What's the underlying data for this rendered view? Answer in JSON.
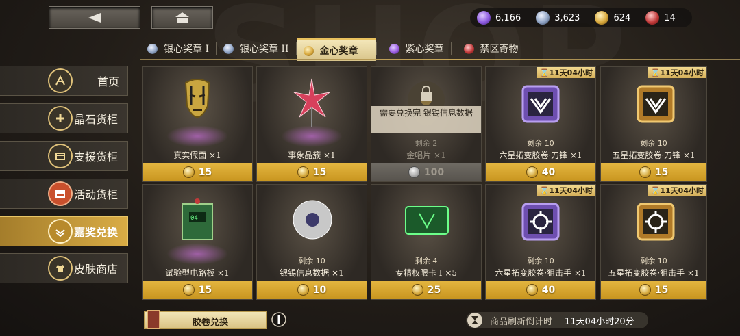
{
  "currencies": [
    {
      "icon": "purple-crystal-icon",
      "value": "6,166",
      "color": "#8d5be0"
    },
    {
      "icon": "silver-badge-icon",
      "value": "3,623",
      "color": "#8fa3c4"
    },
    {
      "icon": "gold-badge-icon",
      "value": "624",
      "color": "#d8a83c"
    },
    {
      "icon": "red-token-icon",
      "value": "14",
      "color": "#c23a3a"
    }
  ],
  "tabs": [
    {
      "label": "银心奖章 I",
      "gem": "#8fa3c4"
    },
    {
      "label": "银心奖章 II",
      "gem": "#8fa3c4"
    },
    {
      "label": "金心奖章",
      "gem": "#d8a83c"
    },
    {
      "label": "紫心奖章",
      "gem": "#9a5de0"
    },
    {
      "label": "禁区奇物",
      "gem": "#c23a3a"
    }
  ],
  "sidebar": [
    {
      "label": "首页",
      "icon": "home-icon"
    },
    {
      "label": "晶石货柜",
      "icon": "crystal-icon"
    },
    {
      "label": "支援货柜",
      "icon": "supply-box-icon"
    },
    {
      "label": "活动货柜",
      "icon": "event-box-icon"
    },
    {
      "label": "嘉奖兑换",
      "icon": "reward-exchange-icon"
    },
    {
      "label": "皮肤商店",
      "icon": "skin-shop-icon"
    }
  ],
  "items": [
    {
      "name": "真实假面 ×1",
      "price": "15",
      "remain": "",
      "timer": ""
    },
    {
      "name": "事象晶簇 ×1",
      "price": "15",
      "remain": "",
      "timer": ""
    },
    {
      "name": "金唱片 ×1",
      "price": "100",
      "remain": "剩余 2",
      "timer": "",
      "lock_text": "需要兑换完 银锡信息数据"
    },
    {
      "name": "六星拓变胶卷·刀锋 ×1",
      "price": "40",
      "remain": "剩余 10",
      "timer": "11天04小时"
    },
    {
      "name": "五星拓变胶卷·刀锋 ×1",
      "price": "15",
      "remain": "剩余 10",
      "timer": "11天04小时"
    },
    {
      "name": "试验型电路板 ×1",
      "price": "15",
      "remain": "",
      "timer": ""
    },
    {
      "name": "银锡信息数据 ×1",
      "price": "10",
      "remain": "剩余 10",
      "timer": ""
    },
    {
      "name": "专精权限卡 I ×5",
      "price": "25",
      "remain": "剩余 4",
      "timer": ""
    },
    {
      "name": "六星拓变胶卷·狙击手 ×1",
      "price": "40",
      "remain": "剩余 10",
      "timer": "11天04小时"
    },
    {
      "name": "五星拓变胶卷·狙击手 ×1",
      "price": "15",
      "remain": "剩余 10",
      "timer": "11天04小时"
    }
  ],
  "bottom": {
    "exchange_label": "胶卷兑换",
    "refresh_label": "商品刷新倒计时",
    "refresh_value": "11天04小时20分"
  },
  "colors": {
    "accent": "#d9ac45",
    "price_bar": "#d8a83c"
  }
}
